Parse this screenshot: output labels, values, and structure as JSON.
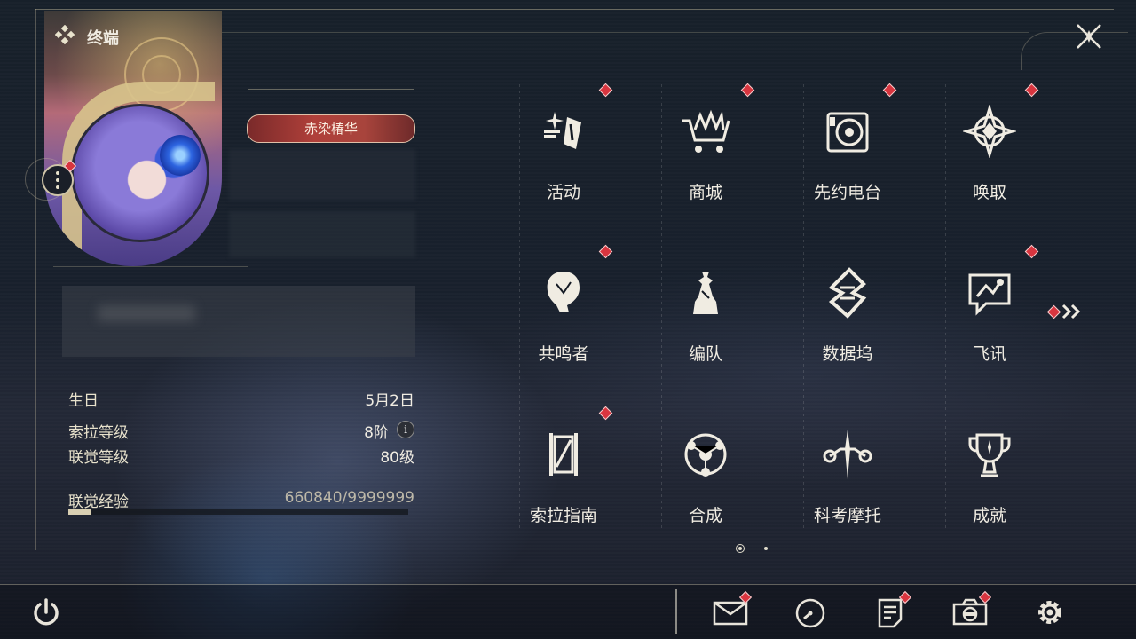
{
  "header": {
    "title": "终端"
  },
  "profile": {
    "title_badge": "赤染椿华",
    "stats": {
      "birthday_label": "生日",
      "birthday_value": "5月2日",
      "sola_level_label": "索拉等级",
      "sola_level_value": "8阶",
      "union_level_label": "联觉等级",
      "union_level_value": "80级",
      "union_exp_label": "联觉经验",
      "union_exp_value": "660840/9999999",
      "union_exp_progress": 0.066
    }
  },
  "menu": {
    "items": [
      {
        "label": "活动",
        "icon": "activity-icon",
        "badge": true
      },
      {
        "label": "商城",
        "icon": "shop-cart-icon",
        "badge": true
      },
      {
        "label": "先约电台",
        "icon": "radio-icon",
        "badge": true
      },
      {
        "label": "唤取",
        "icon": "convene-icon",
        "badge": true
      },
      {
        "label": "共鸣者",
        "icon": "resonator-icon",
        "badge": true
      },
      {
        "label": "编队",
        "icon": "team-chess-icon",
        "badge": false
      },
      {
        "label": "数据坞",
        "icon": "data-bank-icon",
        "badge": false
      },
      {
        "label": "飞讯",
        "icon": "messenger-icon",
        "badge": true
      },
      {
        "label": "索拉指南",
        "icon": "guide-book-icon",
        "badge": true
      },
      {
        "label": "合成",
        "icon": "synthesis-icon",
        "badge": false
      },
      {
        "label": "科考摩托",
        "icon": "motorcycle-icon",
        "badge": false
      },
      {
        "label": "成就",
        "icon": "trophy-icon",
        "badge": false
      }
    ],
    "pages": 2,
    "current_page": 1
  },
  "toolbar": {
    "items": [
      {
        "icon": "mail-icon",
        "badge": true
      },
      {
        "icon": "clock-icon",
        "badge": false
      },
      {
        "icon": "notice-icon",
        "badge": true
      },
      {
        "icon": "camera-icon",
        "badge": true
      },
      {
        "icon": "settings-gear-icon",
        "badge": false
      }
    ]
  },
  "colors": {
    "accent_red": "#d8353f",
    "gold": "#d8c48c",
    "text": "#f0ece2"
  }
}
